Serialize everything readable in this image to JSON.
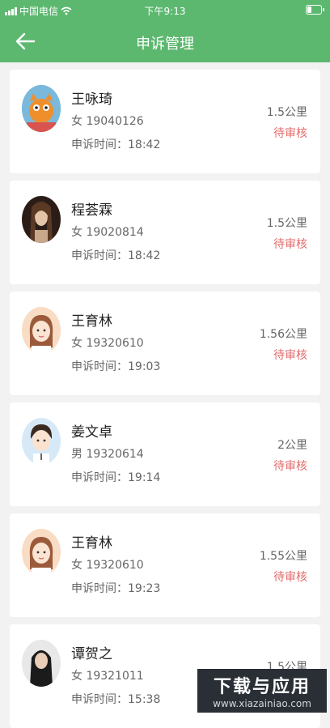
{
  "status_bar": {
    "carrier": "中国电信",
    "time": "下午9:13"
  },
  "header": {
    "title": "申诉管理"
  },
  "records": [
    {
      "name": "王咏琦",
      "info": "女  19040126",
      "time": "申诉时间：18:42",
      "distance": "1.5公里",
      "status": "待审核"
    },
    {
      "name": "程荟霖",
      "info": "女  19020814",
      "time": "申诉时间：18:42",
      "distance": "1.5公里",
      "status": "待审核"
    },
    {
      "name": "王育林",
      "info": "女  19320610",
      "time": "申诉时间：19:03",
      "distance": "1.56公里",
      "status": "待审核"
    },
    {
      "name": "姜文卓",
      "info": "男  19320614",
      "time": "申诉时间：19:14",
      "distance": "2公里",
      "status": "待审核"
    },
    {
      "name": "王育林",
      "info": "女  19320610",
      "time": "申诉时间：19:23",
      "distance": "1.55公里",
      "status": "待审核"
    },
    {
      "name": "谭贺之",
      "info": "女  19321011",
      "time": "申诉时间：15:38",
      "distance": "1.5公里",
      "status": ""
    }
  ],
  "watermark": {
    "line1": "下载与应用",
    "line2": "www.xiazainiao.com"
  },
  "colors": {
    "header": "#5cb86f",
    "pending": "#e36b6b"
  }
}
